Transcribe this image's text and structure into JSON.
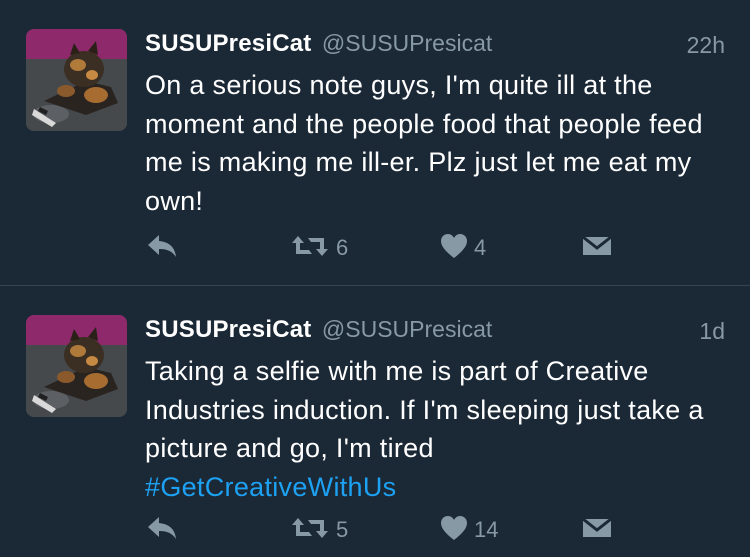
{
  "colors": {
    "background": "#1b2836",
    "text": "#ffffff",
    "muted": "#8899a6",
    "link": "#1da1f2",
    "divider": "#38444d"
  },
  "tweets": [
    {
      "display_name": "SUSUPresiCat",
      "handle": "@SUSUPresicat",
      "time": "22h",
      "text": "On a serious note guys, I'm quite ill at the moment and the people food that people feed me is making me ill-er. Plz just let me eat my own!",
      "hashtag": "",
      "retweets": "6",
      "likes": "4",
      "icons": [
        "reply-icon",
        "retweet-icon",
        "like-icon",
        "direct-message-icon"
      ]
    },
    {
      "display_name": "SUSUPresiCat",
      "handle": "@SUSUPresicat",
      "time": "1d",
      "text": "Taking a selfie with me is part of Creative Industries induction. If I'm sleeping just take a picture and go, I'm tired",
      "hashtag": "#GetCreativeWithUs",
      "retweets": "5",
      "likes": "14",
      "icons": [
        "reply-icon",
        "retweet-icon",
        "like-icon",
        "direct-message-icon"
      ]
    }
  ]
}
